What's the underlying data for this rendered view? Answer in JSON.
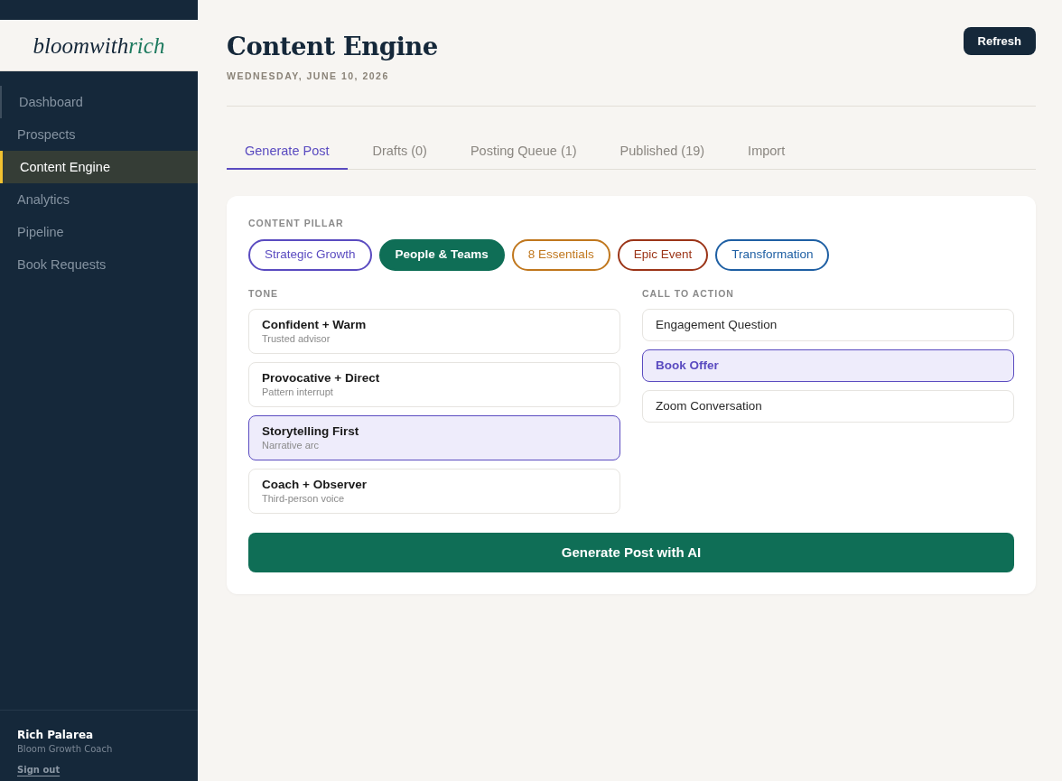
{
  "sidebar": {
    "brand": [
      {
        "text": "bloomwith",
        "kind": "plain"
      },
      {
        "text": "rich",
        "kind": "accent"
      }
    ],
    "items": [
      {
        "label": "Dashboard",
        "selected": false,
        "hovered": true
      },
      {
        "label": "Prospects",
        "selected": false,
        "hovered": false
      },
      {
        "label": "Content Engine",
        "selected": true,
        "hovered": false
      },
      {
        "label": "Analytics",
        "selected": false,
        "hovered": false
      },
      {
        "label": "Pipeline",
        "selected": false,
        "hovered": false
      },
      {
        "label": "Book Requests",
        "selected": false,
        "hovered": false
      }
    ],
    "user": {
      "name": "Rich Palarea",
      "role": "Bloom Growth Coach",
      "sign_out": "Sign out"
    }
  },
  "header": {
    "title": "Content Engine",
    "date": "WEDNESDAY, JUNE 10, 2026",
    "refresh": "Refresh"
  },
  "tabs": [
    {
      "label": "Generate Post",
      "selected": true
    },
    {
      "label": "Drafts (0)",
      "selected": false
    },
    {
      "label": "Posting Queue (1)",
      "selected": false
    },
    {
      "label": "Published (19)",
      "selected": false
    },
    {
      "label": "Import",
      "selected": false
    }
  ],
  "form": {
    "pillar": {
      "label": "CONTENT PILLAR",
      "options": [
        {
          "label": "Strategic Growth",
          "color": "#5a4bc0",
          "selected": false
        },
        {
          "label": "People & Teams",
          "color": "#0f6e56",
          "selected": true
        },
        {
          "label": "8 Essentials",
          "color": "#c0771d",
          "selected": false
        },
        {
          "label": "Epic Event",
          "color": "#9b3417",
          "selected": false
        },
        {
          "label": "Transformation",
          "color": "#1e5fa3",
          "selected": false
        }
      ]
    },
    "tone": {
      "label": "TONE",
      "options": [
        {
          "title": "Confident + Warm",
          "subtitle": "Trusted advisor",
          "selected": false
        },
        {
          "title": "Provocative + Direct",
          "subtitle": "Pattern interrupt",
          "selected": false
        },
        {
          "title": "Storytelling First",
          "subtitle": "Narrative arc",
          "selected": true
        },
        {
          "title": "Coach + Observer",
          "subtitle": "Third-person voice",
          "selected": false
        }
      ]
    },
    "cta": {
      "label": "CALL TO ACTION",
      "options": [
        {
          "label": "Engagement Question",
          "selected": false
        },
        {
          "label": "Book Offer",
          "selected": true
        },
        {
          "label": "Zoom Conversation",
          "selected": false
        }
      ]
    },
    "submit": "Generate Post with AI"
  }
}
